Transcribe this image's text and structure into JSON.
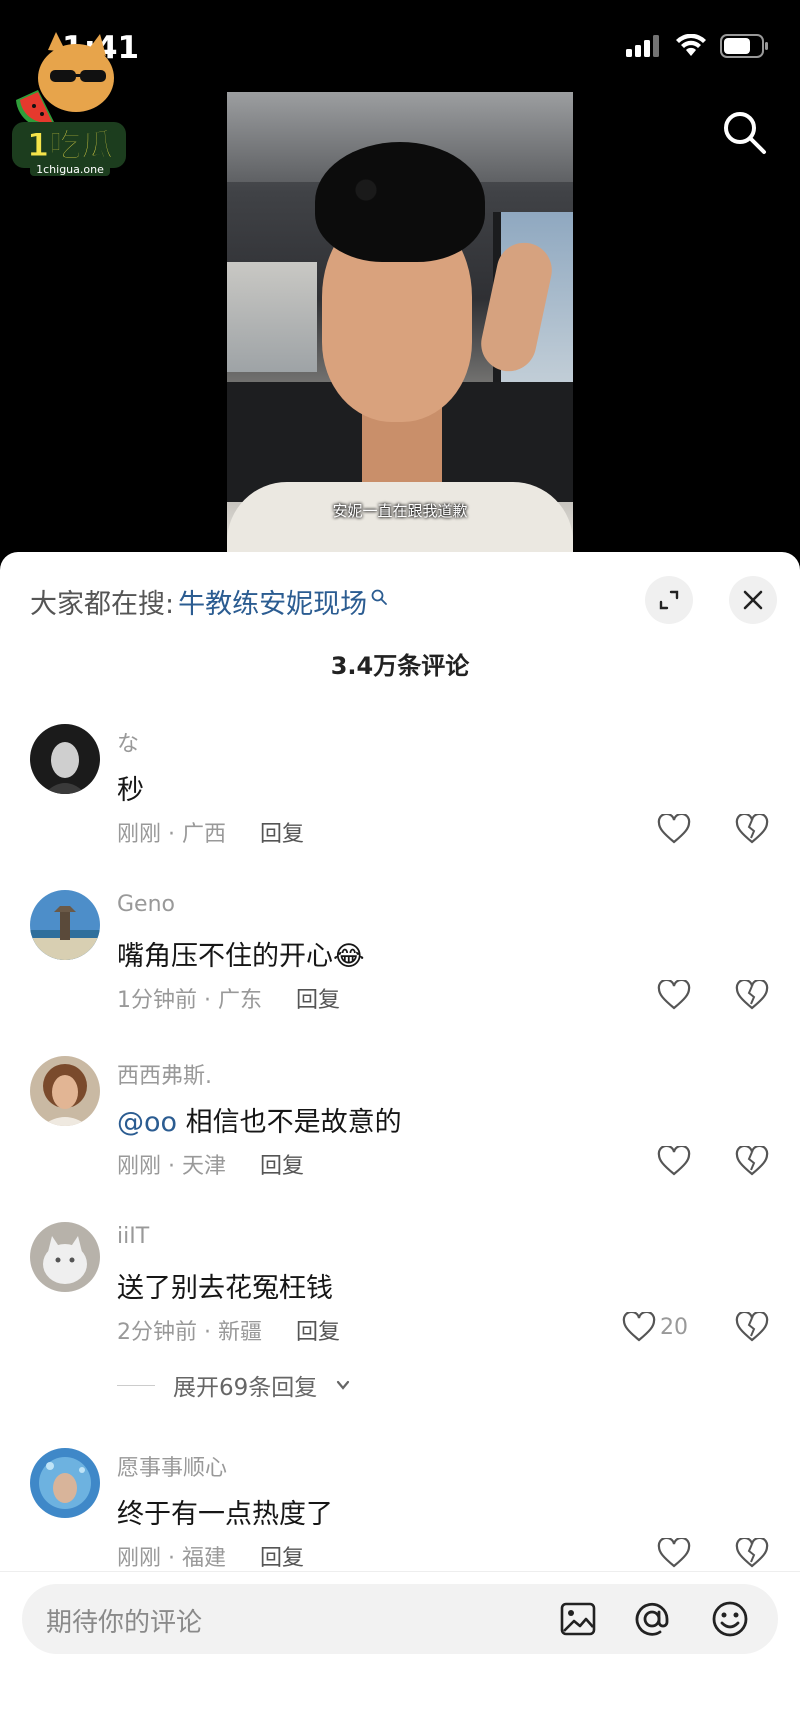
{
  "status": {
    "time": "1:41"
  },
  "logo": {
    "name": "1吃瓜",
    "domain": "1chigua.one"
  },
  "video": {
    "subtitle": "安妮一直在跟我道歉"
  },
  "comments_panel": {
    "hot_search_label": "大家都在搜:",
    "hot_search_term": "牛教练安妮现场",
    "comment_count": "3.4万条评论",
    "reply_label": "回复",
    "comments": [
      {
        "user": "な",
        "text": "秒",
        "time": "刚刚",
        "location": "广西",
        "likes": ""
      },
      {
        "user": "Geno",
        "text": "嘴角压不住的开心",
        "emoji": "😂",
        "time": "1分钟前",
        "location": "广东",
        "likes": ""
      },
      {
        "user": "西西弗斯.",
        "mention": "@oo",
        "text": "相信也不是故意的",
        "time": "刚刚",
        "location": "天津",
        "likes": ""
      },
      {
        "user": "iiIT",
        "text": "送了别去花冤枉钱",
        "time": "2分钟前",
        "location": "新疆",
        "likes": "20"
      },
      {
        "user": "愿事事顺心",
        "text": "终于有一点热度了",
        "time": "刚刚",
        "location": "福建",
        "likes": ""
      }
    ],
    "expand_replies": "展开69条回复"
  },
  "input": {
    "placeholder": "期待你的评论"
  },
  "colors": {
    "link": "#2b5c91",
    "meta": "#999999",
    "panel_bg": "#ffffff"
  }
}
